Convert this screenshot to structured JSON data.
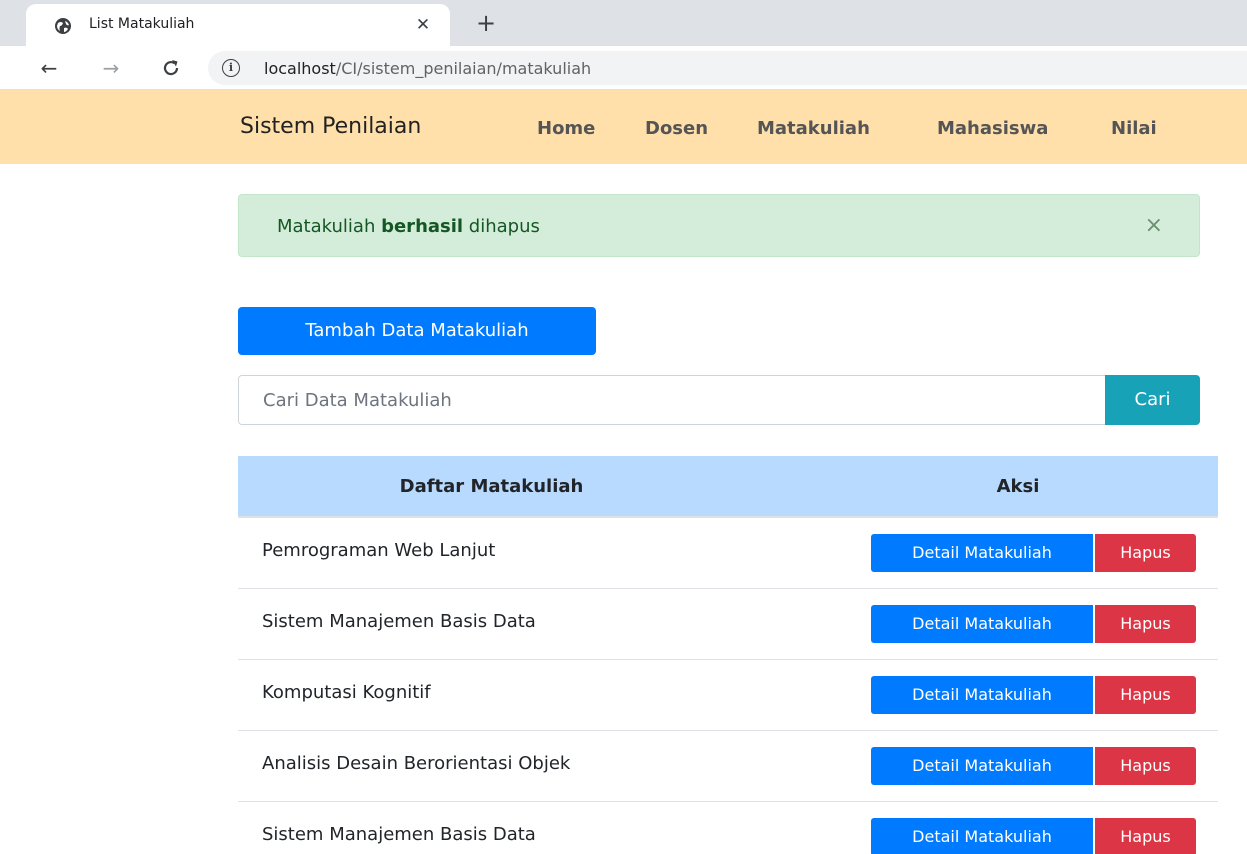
{
  "browser": {
    "tab_title": "List Matakuliah",
    "tab_favicon": "globe-icon",
    "url_host": "localhost",
    "url_path": "/CI/sistem_penilaian/matakuliah"
  },
  "navbar": {
    "brand": "Sistem Penilaian",
    "links": [
      "Home",
      "Dosen",
      "Matakuliah",
      "Mahasiswa",
      "Nilai"
    ],
    "background": "#ffdfaa"
  },
  "alert": {
    "prefix": "Matakuliah ",
    "bold": "berhasil",
    "suffix": " dihapus",
    "close_symbol": "×"
  },
  "add_button": {
    "label": "Tambah Data Matakuliah"
  },
  "search": {
    "placeholder": "Cari Data Matakuliah",
    "button_label": "Cari"
  },
  "table": {
    "headers": {
      "name": "Daftar Matakuliah",
      "actions": "Aksi"
    },
    "detail_label": "Detail Matakuliah",
    "delete_label": "Hapus",
    "rows": [
      "Pemrograman Web Lanjut",
      "Sistem Manajemen Basis Data",
      "Komputasi Kognitif",
      "Analisis Desain Berorientasi Objek",
      "Sistem Manajemen Basis Data"
    ]
  },
  "colors": {
    "primary": "#007bff",
    "danger": "#dc3545",
    "info": "#17a2b8",
    "alert_success_bg": "#d4edda",
    "table_header_bg": "#b8daff"
  }
}
